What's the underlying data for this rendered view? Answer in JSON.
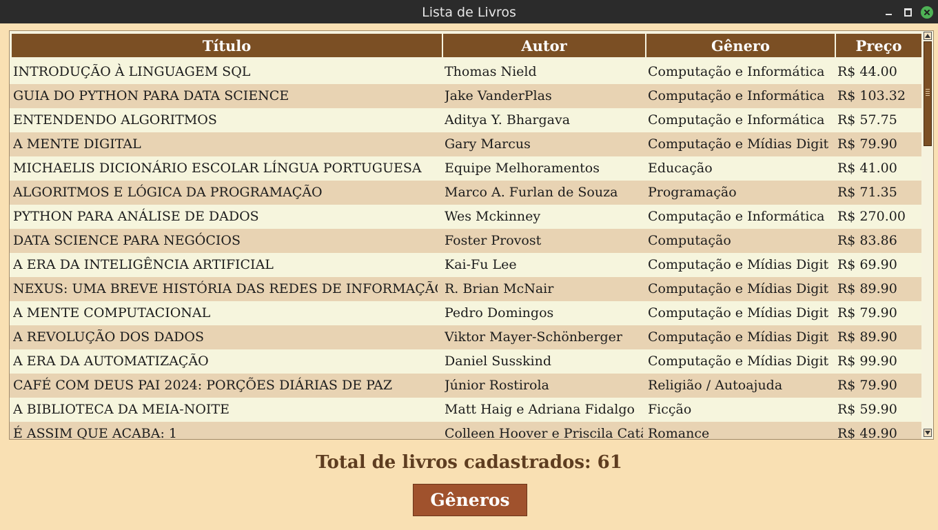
{
  "window": {
    "title": "Lista de Livros"
  },
  "table": {
    "columns": [
      "Título",
      "Autor",
      "Gênero",
      "Preço"
    ],
    "rows": [
      [
        "INTRODUÇÃO À LINGUAGEM SQL",
        "Thomas Nield",
        "Computação e Informática",
        "R$ 44.00"
      ],
      [
        "GUIA DO PYTHON PARA DATA SCIENCE",
        "Jake VanderPlas",
        "Computação e Informática",
        "R$ 103.32"
      ],
      [
        "ENTENDENDO ALGORITMOS",
        "Aditya Y. Bhargava",
        "Computação e Informática",
        "R$ 57.75"
      ],
      [
        "A MENTE DIGITAL",
        "Gary Marcus",
        "Computação e Mídias Digitais",
        "R$ 79.90"
      ],
      [
        "MICHAELIS DICIONÁRIO ESCOLAR LÍNGUA PORTUGUESA",
        "Equipe Melhoramentos",
        "Educação",
        "R$ 41.00"
      ],
      [
        "ALGORITMOS E LÓGICA DA PROGRAMAÇÃO",
        "Marco A. Furlan de Souza",
        "Programação",
        "R$ 71.35"
      ],
      [
        "PYTHON PARA ANÁLISE DE DADOS",
        "Wes Mckinney",
        "Computação e Informática",
        "R$ 270.00"
      ],
      [
        "DATA SCIENCE PARA NEGÓCIOS",
        "Foster Provost",
        "Computação",
        "R$ 83.86"
      ],
      [
        "A ERA DA INTELIGÊNCIA ARTIFICIAL",
        "Kai-Fu Lee",
        "Computação e Mídias Digitais",
        "R$ 69.90"
      ],
      [
        "NEXUS: UMA BREVE HISTÓRIA DAS REDES DE INFORMAÇÃO",
        "R. Brian McNair",
        "Computação e Mídias Digitais",
        "R$ 89.90"
      ],
      [
        "A MENTE COMPUTACIONAL",
        "Pedro Domingos",
        "Computação e Mídias Digitais",
        "R$ 79.90"
      ],
      [
        "A REVOLUÇÃO DOS DADOS",
        "Viktor Mayer-Schönberger",
        "Computação e Mídias Digitais",
        "R$ 89.90"
      ],
      [
        "A ERA DA AUTOMATIZAÇÃO",
        "Daniel Susskind",
        "Computação e Mídias Digitais",
        "R$ 99.90"
      ],
      [
        "CAFÉ COM DEUS PAI 2024: PORÇÕES DIÁRIAS DE PAZ",
        "Júnior Rostirola",
        "Religião / Autoajuda",
        "R$ 79.90"
      ],
      [
        "A BIBLIOTECA DA MEIA-NOITE",
        "Matt Haig e Adriana Fidalgo",
        "Ficção",
        "R$ 59.90"
      ],
      [
        "É ASSIM QUE ACABA: 1",
        "Colleen Hoover e Priscila Catão",
        "Romance",
        "R$ 49.90"
      ]
    ]
  },
  "footer": {
    "total_label": "Total de livros cadastrados: 61",
    "genres_button": "Gêneros"
  },
  "colors": {
    "background": "#f9e0b3",
    "header": "#7b4f24",
    "row_odd": "#f6f5dd",
    "row_even": "#e8d3b3",
    "button": "#a0522d"
  }
}
